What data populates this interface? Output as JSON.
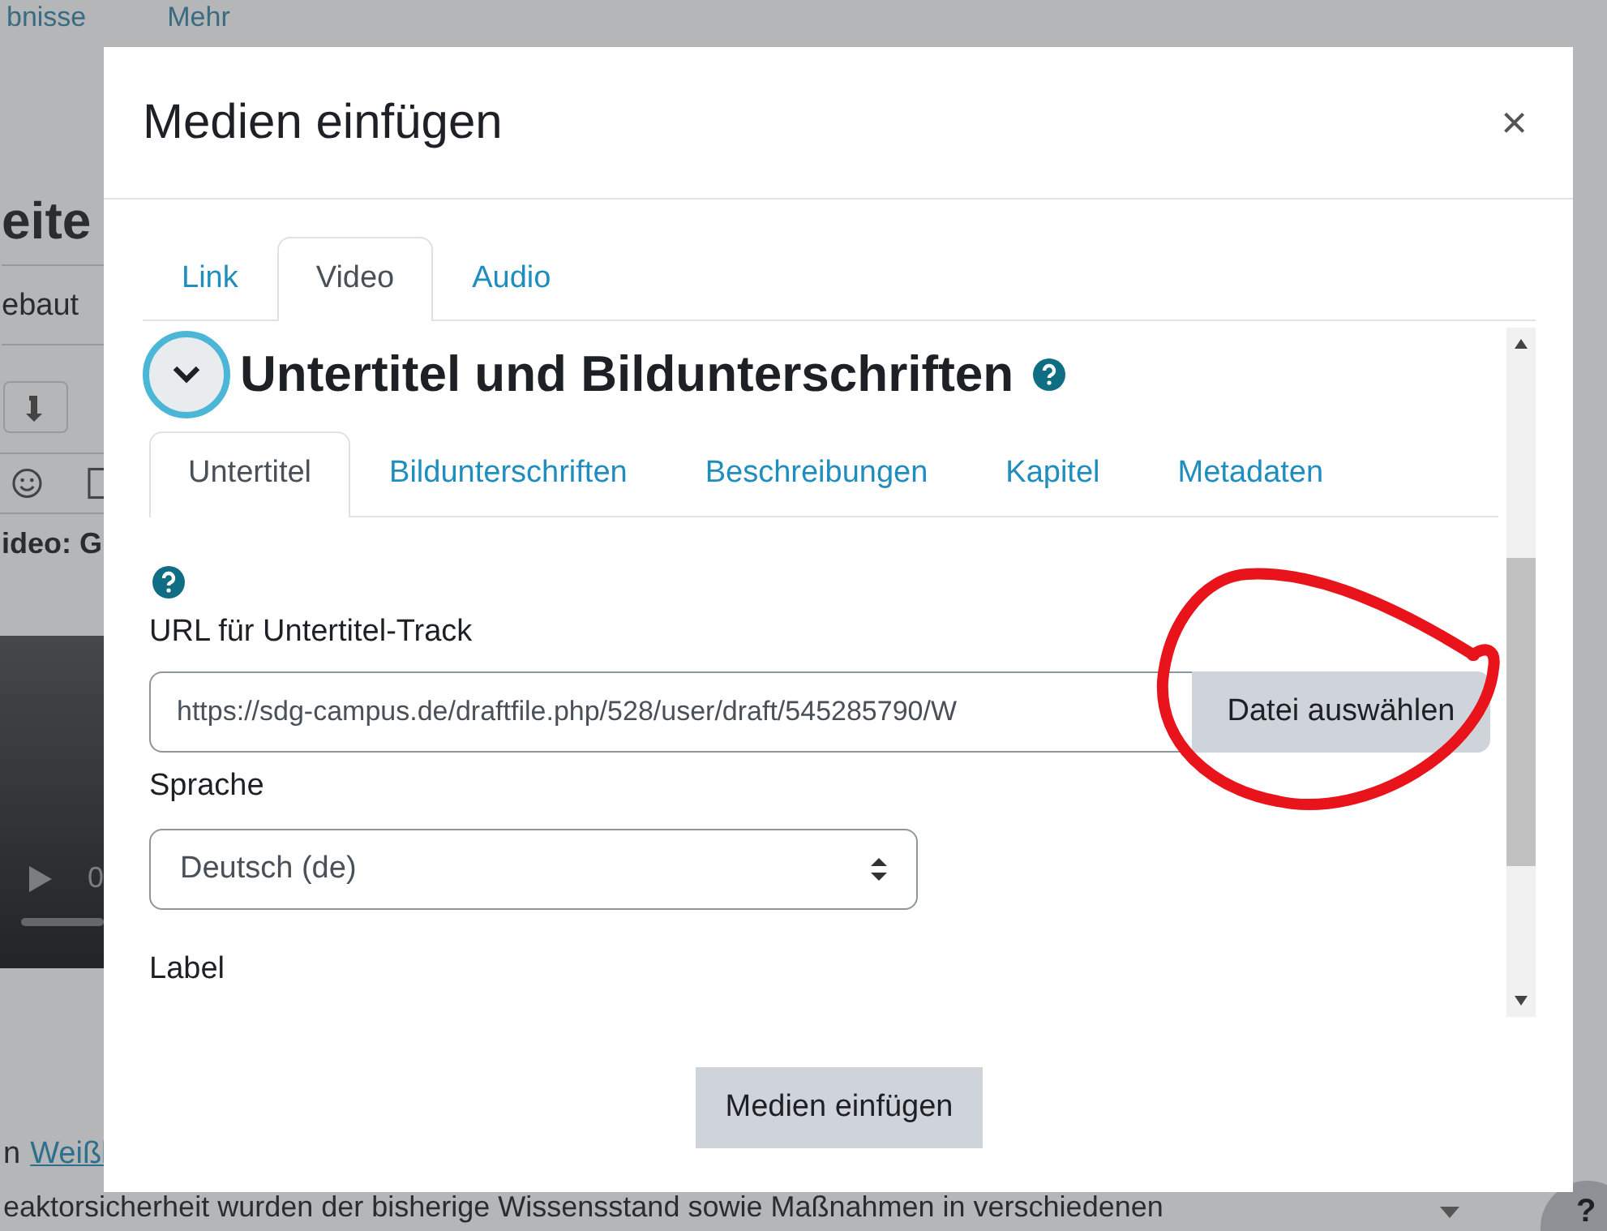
{
  "background": {
    "nav": [
      "bnisse",
      "Mehr"
    ],
    "page_title": "eite",
    "subtitle": "ebaut",
    "video_label": "ideo: G",
    "video_time": "0",
    "link_prefix": "n",
    "link": "Weißl",
    "paragraph": "eaktorsicherheit wurden der bisherige Wissensstand sowie Maßnahmen in verschiedenen",
    "help_button": "?"
  },
  "dialog": {
    "title": "Medien einfügen",
    "close": "×",
    "tabs": [
      {
        "label": "Link",
        "selected": false
      },
      {
        "label": "Video",
        "selected": true
      },
      {
        "label": "Audio",
        "selected": false
      }
    ],
    "section": {
      "title": "Untertitel und Bildunterschriften",
      "expanded": true,
      "tabs": [
        {
          "label": "Untertitel",
          "selected": true
        },
        {
          "label": "Bildunterschriften",
          "selected": false
        },
        {
          "label": "Beschreibungen",
          "selected": false
        },
        {
          "label": "Kapitel",
          "selected": false
        },
        {
          "label": "Metadaten",
          "selected": false
        }
      ],
      "url_label": "URL für Untertitel-Track",
      "url_value": "https://sdg-campus.de/draftfile.php/528/user/draft/545285790/W",
      "browse_button": "Datei auswählen",
      "language_label": "Sprache",
      "language_value": "Deutsch (de)",
      "label_label": "Label"
    },
    "submit": "Medien einfügen"
  }
}
